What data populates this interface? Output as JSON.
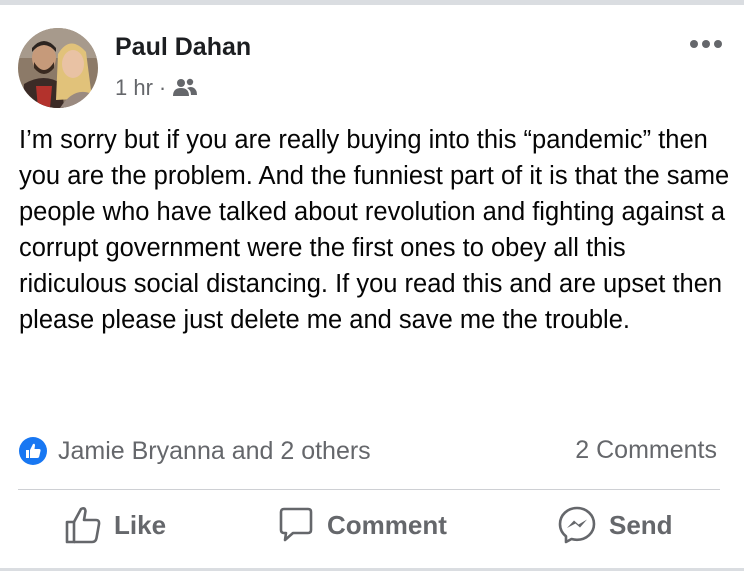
{
  "post": {
    "author": "Paul Dahan",
    "time": "1 hr",
    "separator": "·",
    "privacy_icon": "friends-icon",
    "text": "I’m sorry but if you are really buying into this “pandemic” then you are the problem. And the funniest part of it is that the same people who have talked about revolution and fighting against a corrupt government were the first ones to obey all this ridiculous social distancing. If you read this and are upset then please please just delete me and save me the trouble."
  },
  "engagement": {
    "reactions_text": "Jamie Bryanna and 2 others",
    "comments_text": "2 Comments"
  },
  "actions": {
    "like_label": "Like",
    "comment_label": "Comment",
    "send_label": "Send"
  },
  "colors": {
    "text_primary": "#050505",
    "text_secondary": "#65676b",
    "like_blue": "#1877f2",
    "divider": "#ced0d4"
  }
}
